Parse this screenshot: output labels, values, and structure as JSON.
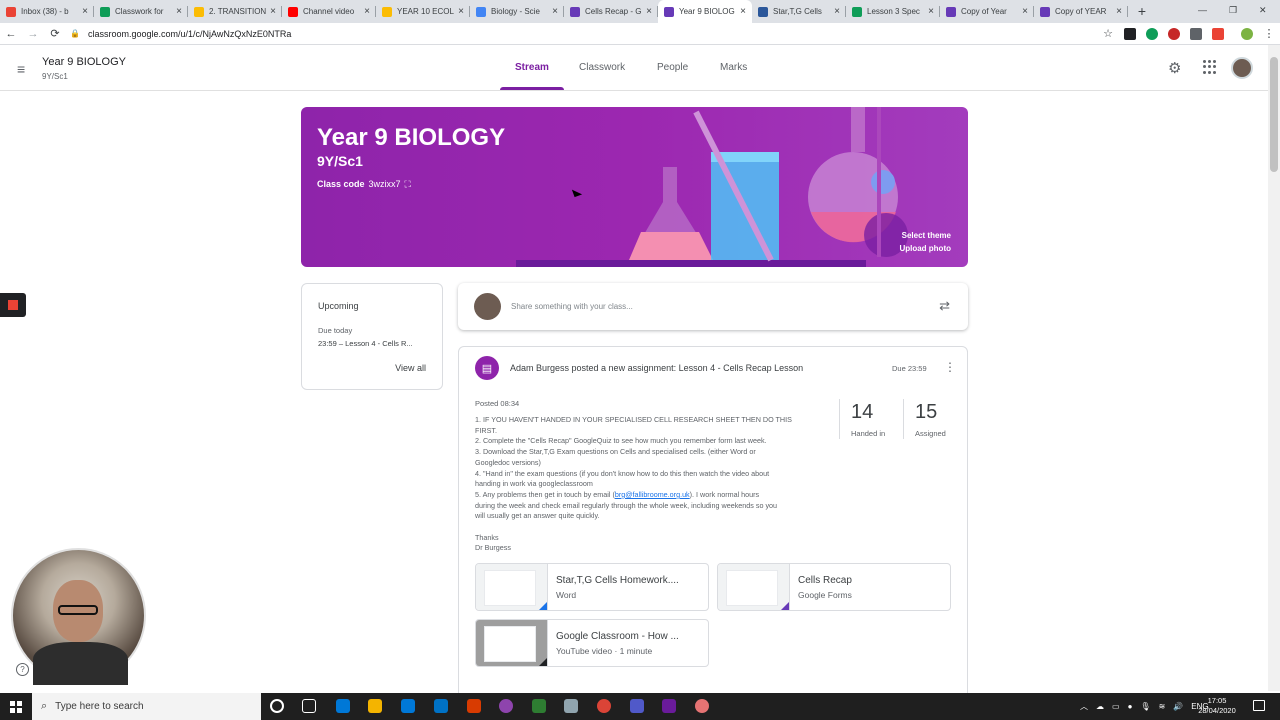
{
  "browser": {
    "tabs": [
      {
        "title": "Inbox (38) - b",
        "color": "#ea4335",
        "active": false
      },
      {
        "title": "Classwork for",
        "color": "#0f9d58",
        "active": false
      },
      {
        "title": "2. TRANSITION",
        "color": "#fbbc04",
        "active": false
      },
      {
        "title": "Channel video",
        "color": "#ff0000",
        "active": false
      },
      {
        "title": "YEAR 10 ECOL",
        "color": "#fbbc04",
        "active": false
      },
      {
        "title": "Biology - Scie",
        "color": "#4285f4",
        "active": false
      },
      {
        "title": "Cells Recap - G",
        "color": "#673ab7",
        "active": false
      },
      {
        "title": "Year 9 BIOLOG",
        "color": "#673ab7",
        "active": true
      },
      {
        "title": "Star,T,G Cells",
        "color": "#2b579a",
        "active": false
      },
      {
        "title": "Lesson 3 Spec",
        "color": "#0f9d58",
        "active": false
      },
      {
        "title": "Copy of Year",
        "color": "#673ab7",
        "active": false
      },
      {
        "title": "Copy of YEAR",
        "color": "#673ab7",
        "active": false
      }
    ],
    "new_tab": "+",
    "url": "classroom.google.com/u/1/c/NjAwNzQxNzE0NTRa",
    "back": "←",
    "forward": "→",
    "reload": "⟳",
    "star": "☆"
  },
  "classroom": {
    "class_name": "Year 9 BIOLOGY",
    "section": "9Y/Sc1",
    "menu": "≡",
    "tabs": [
      "Stream",
      "Classwork",
      "People",
      "Marks"
    ],
    "active_tab": "Stream",
    "accent": "#7b1fa2",
    "banner": {
      "title": "Year 9 BIOLOGY",
      "section": "9Y/Sc1",
      "class_code_label": "Class code",
      "class_code": "3wzixx7",
      "select_theme": "Select theme",
      "upload_photo": "Upload photo"
    },
    "upcoming": {
      "title": "Upcoming",
      "due": "Due today",
      "item": "23:59 – Lesson 4 - Cells R...",
      "view_all": "View all"
    },
    "share_placeholder": "Share something with your class...",
    "post": {
      "headline": "Adam Burgess posted a new assignment: Lesson 4 - Cells Recap Lesson",
      "due": "Due 23:59",
      "posted": "Posted 08:34",
      "lines": [
        "1. IF YOU HAVEN'T HANDED IN YOUR SPECIALISED CELL RESEARCH SHEET THEN DO THIS",
        "FIRST.",
        "2. Complete the \"Cells Recap\" GoogleQuiz to see how much you remember form last week.",
        "3. Download the Star,T,G Exam questions on Cells and specialised cells. (either Word or",
        "Googledoc versions)",
        "4. \"Hand in\" the exam questions (if you don't know how to do this then watch the video about",
        "handing in work via googleclassroom",
        "5. Any problems then get in touch by email (",
        "during the week and check email regularly through the whole week, including weekends so you",
        "will usually get an answer quite quickly.",
        "",
        "Thanks",
        "Dr Burgess"
      ],
      "email": "brg@fallibroome.org.uk",
      "email_suffix": "). I work normal hours",
      "handed_in": "14",
      "handed_in_label": "Handed in",
      "assigned": "15",
      "assigned_label": "Assigned",
      "attachments": [
        {
          "name": "Star,T,G Cells Homework....",
          "type": "Word",
          "corner": "#1a73e8"
        },
        {
          "name": "Cells Recap",
          "type": "Google Forms",
          "corner": "#673ab7"
        },
        {
          "name": "Google Classroom - How ...",
          "type": "YouTube video · 1 minute",
          "corner": "#202124"
        }
      ]
    }
  },
  "taskbar": {
    "search_placeholder": "Type here to search",
    "language": "ENG",
    "time": "17:05",
    "date": "28/04/2020"
  }
}
